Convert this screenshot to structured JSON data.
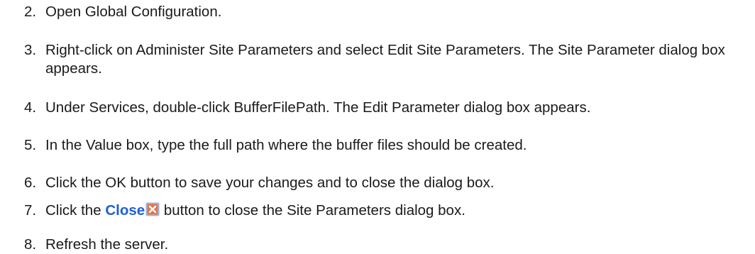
{
  "steps": [
    {
      "number": "2.",
      "text": "Open Global Configuration."
    },
    {
      "number": "3.",
      "text": "Right-click on Administer Site Parameters and select Edit Site Parameters. The Site Parameter dialog box appears."
    },
    {
      "number": "4.",
      "text": "Under Services, double-click BufferFilePath. The Edit Parameter dialog box appears."
    },
    {
      "number": "5.",
      "text": "In the Value box, type the full path where the buffer files should be created."
    },
    {
      "number": "6.",
      "text": "Click the OK button to save your changes and to close the dialog box."
    },
    {
      "number": "7.",
      "text_before": "Click the ",
      "link": "Close",
      "text_after": " button to close the Site Parameters dialog box."
    },
    {
      "number": "8.",
      "text": "Refresh the server."
    }
  ],
  "colors": {
    "link": "#1f5fd6",
    "close_icon_fill": "#e8744a",
    "close_icon_border": "#9ab6e6"
  },
  "icons": {
    "close": "close-icon"
  }
}
